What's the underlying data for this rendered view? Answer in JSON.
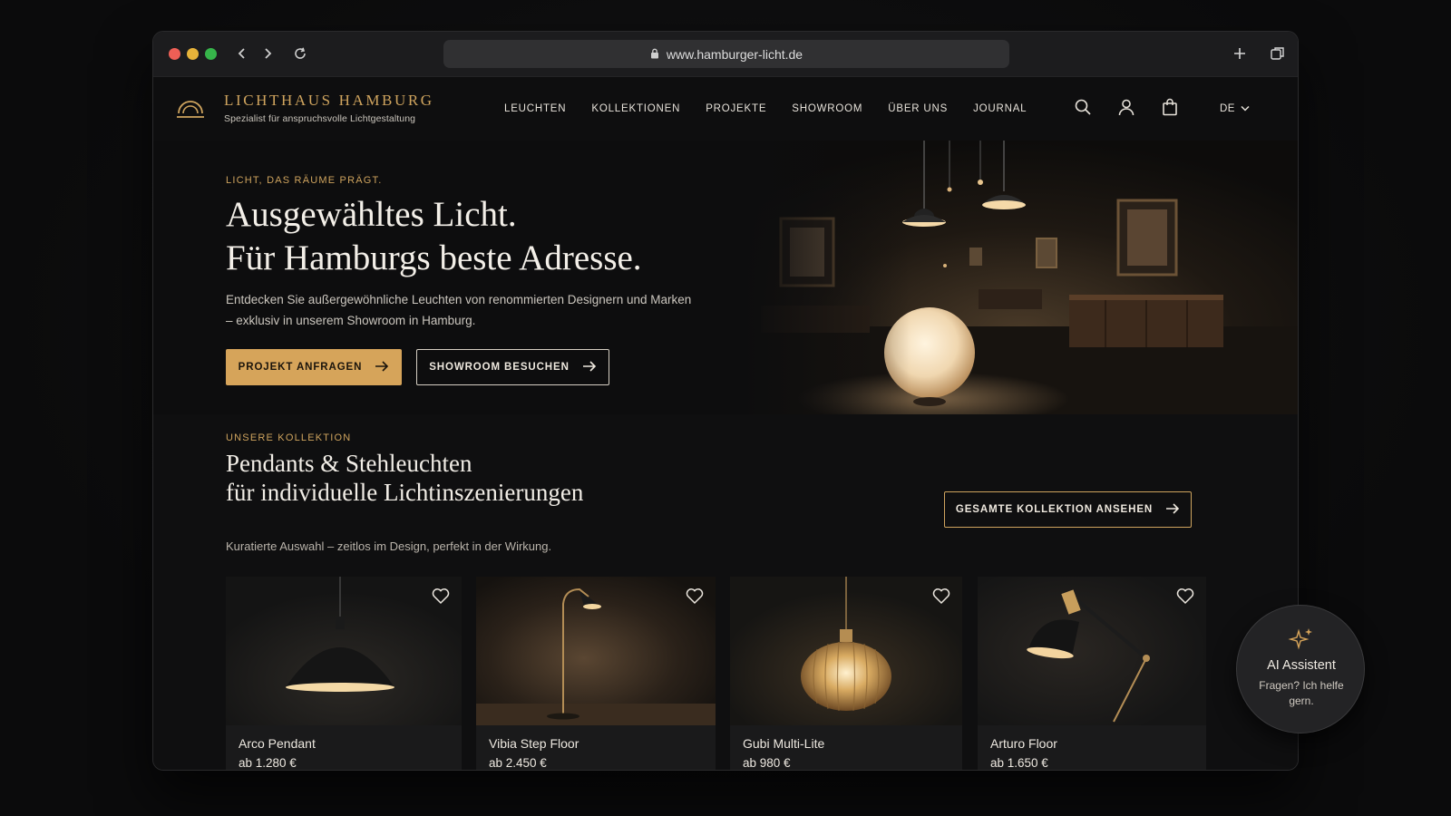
{
  "browser": {
    "url": "www.hamburger-licht.de",
    "icons": [
      "back-icon",
      "forward-icon",
      "reload-icon",
      "lock-icon",
      "new-tab-icon",
      "tabs-icon"
    ]
  },
  "header": {
    "brand_name": "LICHTHAUS HAMBURG",
    "brand_tagline": "Spezialist für anspruchsvolle Lichtgestaltung",
    "menu": [
      "LEUCHTEN",
      "KOLLEKTIONEN",
      "PROJEKTE",
      "SHOWROOM",
      "ÜBER UNS",
      "JOURNAL"
    ],
    "icons": [
      "search-icon",
      "account-icon",
      "shopping-bag-icon"
    ],
    "language": "DE"
  },
  "hero": {
    "eyebrow": "LICHT, DAS RÄUME PRÄGT.",
    "title_line1": "Ausgewähltes Licht.",
    "title_line2": "Für Hamburgs beste Adresse.",
    "lede": "Entdecken Sie außergewöhnliche Leuchten von renommierten Designern und Marken – exklusiv in unserem Showroom in Hamburg.",
    "primary_cta": "PROJEKT ANFRAGEN",
    "secondary_cta": "SHOWROOM BESUCHEN"
  },
  "collection": {
    "eyebrow": "UNSERE KOLLEKTION",
    "title_line1": "Pendants & Stehleuchten",
    "title_line2": "für individuelle Lichtinszenierungen",
    "subtitle": "Kuratierte Auswahl – zeitlos im Design, perfekt in der Wirkung.",
    "view_all": "GESAMTE KOLLEKTION ANSEHEN",
    "products": [
      {
        "name": "Arco Pendant",
        "price": "ab 1.280 €"
      },
      {
        "name": "Vibia Step Floor",
        "price": "ab 2.450 €"
      },
      {
        "name": "Gubi Multi-Lite",
        "price": "ab 980 €"
      },
      {
        "name": "Arturo Floor",
        "price": "ab 1.650 €"
      }
    ]
  },
  "assistant": {
    "title": "AI Assistent",
    "message": "Fragen? Ich helfe gern."
  },
  "colors": {
    "accent_gold": "#d6a45a",
    "brand_gold": "#cfa45e",
    "background": "#0f0f10"
  }
}
